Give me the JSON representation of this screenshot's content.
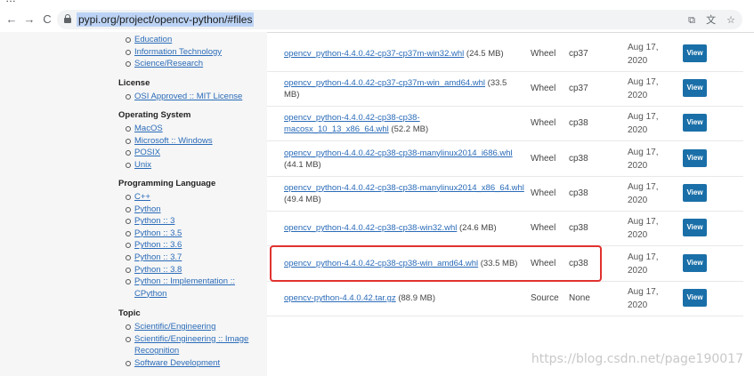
{
  "browser": {
    "url": "pypi.org/project/opencv-python/#files",
    "nav": {
      "back": "←",
      "forward": "→",
      "reload": "C"
    },
    "icons": {
      "cast": "⧉",
      "translate": "文",
      "bookmark": "☆"
    }
  },
  "sidebar": {
    "sections": [
      {
        "title": null,
        "items": [
          {
            "label": "Education"
          },
          {
            "label": "Information Technology"
          },
          {
            "label": "Science/Research"
          }
        ]
      },
      {
        "title": "License",
        "items": [
          {
            "label": "OSI Approved :: MIT License"
          }
        ]
      },
      {
        "title": "Operating System",
        "items": [
          {
            "label": "MacOS"
          },
          {
            "label": "Microsoft :: Windows"
          },
          {
            "label": "POSIX"
          },
          {
            "label": "Unix"
          }
        ]
      },
      {
        "title": "Programming Language",
        "items": [
          {
            "label": "C++"
          },
          {
            "label": "Python"
          },
          {
            "label": "Python :: 3"
          },
          {
            "label": "Python :: 3.5"
          },
          {
            "label": "Python :: 3.6"
          },
          {
            "label": "Python :: 3.7"
          },
          {
            "label": "Python :: 3.8"
          },
          {
            "label": "Python :: Implementation ::",
            "cont": "CPython"
          }
        ]
      },
      {
        "title": "Topic",
        "items": [
          {
            "label": "Scientific/Engineering"
          },
          {
            "label": "Scientific/Engineering :: Image",
            "cont": "Recognition"
          },
          {
            "label": "Software Development"
          }
        ]
      }
    ]
  },
  "files": [
    {
      "name": "opencv_python-4.4.0.42-cp37-cp37m-win32.whl",
      "size": "(24.5 MB)",
      "type": "Wheel",
      "python": "cp37",
      "date_line1": "Aug 17,",
      "date_line2": "2020",
      "button": "View"
    },
    {
      "name": "opencv_python-4.4.0.42-cp37-cp37m-win_amd64.whl",
      "size": "(33.5 MB)",
      "type": "Wheel",
      "python": "cp37",
      "date_line1": "Aug 17,",
      "date_line2": "2020",
      "button": "View"
    },
    {
      "name": "opencv_python-4.4.0.42-cp38-cp38-macosx_10_13_x86_64.whl",
      "size": "(52.2 MB)",
      "type": "Wheel",
      "python": "cp38",
      "date_line1": "Aug 17,",
      "date_line2": "2020",
      "button": "View"
    },
    {
      "name": "opencv_python-4.4.0.42-cp38-cp38-manylinux2014_i686.whl",
      "size": "(44.1 MB)",
      "type": "Wheel",
      "python": "cp38",
      "date_line1": "Aug 17,",
      "date_line2": "2020",
      "button": "View"
    },
    {
      "name": "opencv_python-4.4.0.42-cp38-cp38-manylinux2014_x86_64.whl",
      "size": "(49.4 MB)",
      "type": "Wheel",
      "python": "cp38",
      "date_line1": "Aug 17,",
      "date_line2": "2020",
      "button": "View"
    },
    {
      "name": "opencv_python-4.4.0.42-cp38-cp38-win32.whl",
      "size": "(24.6 MB)",
      "type": "Wheel",
      "python": "cp38",
      "date_line1": "Aug 17,",
      "date_line2": "2020",
      "button": "View"
    },
    {
      "name": "opencv_python-4.4.0.42-cp38-cp38-win_amd64.whl",
      "size": "(33.5 MB)",
      "type": "Wheel",
      "python": "cp38",
      "date_line1": "Aug 17,",
      "date_line2": "2020",
      "button": "View"
    },
    {
      "name": "opencv-python-4.4.0.42.tar.gz",
      "size": "(88.9 MB)",
      "type": "Source",
      "python": "None",
      "date_line1": "Aug 17,",
      "date_line2": "2020",
      "button": "View"
    }
  ],
  "watermark": "https://blog.csdn.net/page190017",
  "colors": {
    "link": "#2a6bb8",
    "button": "#1a6fa8",
    "highlight": "#e0322f"
  }
}
